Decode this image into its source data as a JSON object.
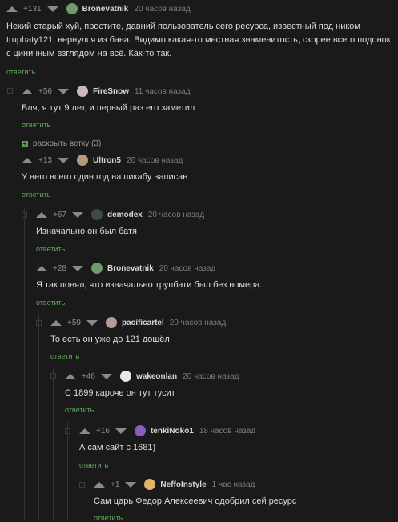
{
  "comments": [
    {
      "rating": "+131",
      "author": "Bronevatnik",
      "time": "20 часов назад",
      "avatar_color": "#6f9a6a",
      "text": "Некий старый хуй, простите, давний пользователь сего ресурса, известный под ником trupbaty121, вернулся из бана. Видимо какая-то местная знаменитость, скорее всего подонок с циничным взглядом на всё. Как-то так.",
      "reply": "ответить"
    },
    {
      "rating": "+56",
      "author": "FireSnow",
      "time": "11 часов назад",
      "avatar_color": "#c9b8b8",
      "text": "Бля, я тут 9 лет, и первый раз его заметил",
      "reply": "ответить"
    },
    {
      "rating": "+13",
      "author": "Ultron5",
      "time": "20 часов назад",
      "avatar_color": "#b89a7a",
      "text": "У него всего один год на пикабу написан",
      "reply": "ответить"
    },
    {
      "rating": "+67",
      "author": "demodex",
      "time": "20 часов назад",
      "avatar_color": "#3d4a3d",
      "text": "Изначально он был батя",
      "reply": "ответить"
    },
    {
      "rating": "+28",
      "author": "Bronevatnik",
      "time": "20 часов назад",
      "avatar_color": "#6f9a6a",
      "text": "Я так понял, что изначально трупбати был без номера.",
      "reply": "ответить"
    },
    {
      "rating": "+59",
      "author": "pacificartel",
      "time": "20 часов назад",
      "avatar_color": "#b59a96",
      "text": "То есть он уже до 121 дошёл",
      "reply": "ответить"
    },
    {
      "rating": "+46",
      "author": "wakeonlan",
      "time": "20 часов назад",
      "avatar_color": "#e8e8e8",
      "text": "С 1899 кароче он тут тусит",
      "reply": "ответить"
    },
    {
      "rating": "+16",
      "author": "tenkiNoko1",
      "time": "18 часов назад",
      "avatar_color": "#8a5cc0",
      "text": "А сам сайт с 1681)",
      "reply": "ответить"
    },
    {
      "rating": "+1",
      "author": "NeffoInstyle",
      "time": "1 час назад",
      "avatar_color": "#e0b56a",
      "text": "Сам царь Федор Алексеевич одобрил сей ресурс",
      "reply": "ответить"
    }
  ],
  "expand_branch": {
    "label": "раскрыть ветку (3)",
    "icon": "plus-icon"
  }
}
